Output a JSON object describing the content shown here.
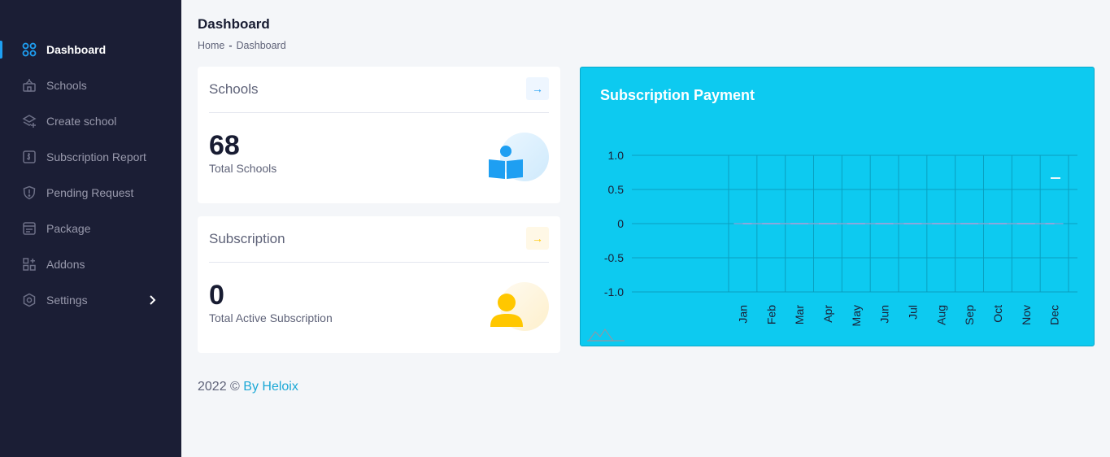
{
  "sidebar": {
    "items": [
      {
        "label": "Dashboard",
        "icon": "grid-icon"
      },
      {
        "label": "Schools",
        "icon": "school-icon"
      },
      {
        "label": "Create school",
        "icon": "layers-plus-icon"
      },
      {
        "label": "Subscription Report",
        "icon": "report-icon"
      },
      {
        "label": "Pending Request",
        "icon": "shield-icon"
      },
      {
        "label": "Package",
        "icon": "package-icon"
      },
      {
        "label": "Addons",
        "icon": "addons-icon"
      },
      {
        "label": "Settings",
        "icon": "gear-icon"
      }
    ]
  },
  "header": {
    "title": "Dashboard",
    "breadcrumb": {
      "home": "Home",
      "sep": "-",
      "current": "Dashboard"
    }
  },
  "cards": {
    "schools": {
      "title": "Schools",
      "value": "68",
      "label": "Total Schools",
      "arrow": "→",
      "arrow_color": "#1e9ff2"
    },
    "subscription": {
      "title": "Subscription",
      "value": "0",
      "label": "Total Active Subscription",
      "arrow": "→",
      "arrow_color": "#ffc700"
    }
  },
  "chart_panel": {
    "title": "Subscription Payment"
  },
  "chart_data": {
    "type": "line",
    "categories": [
      "Jan",
      "Feb",
      "Mar",
      "Apr",
      "May",
      "Jun",
      "Jul",
      "Aug",
      "Sep",
      "Oct",
      "Nov",
      "Dec"
    ],
    "series": [
      {
        "values": [
          0,
          0,
          0,
          0,
          0,
          0,
          0,
          0,
          0,
          0,
          0,
          0
        ]
      }
    ],
    "yticks": [
      "1.0",
      "0.5",
      "0",
      "-0.5",
      "-1.0"
    ],
    "ylim": [
      -1,
      1
    ],
    "grid": true,
    "colors": {
      "background": "#0dcaf0",
      "grid": "#0a9fbf",
      "axis_text": "#1b1e35"
    }
  },
  "footer": {
    "year": "2022 ©",
    "link": "By Heloix"
  }
}
